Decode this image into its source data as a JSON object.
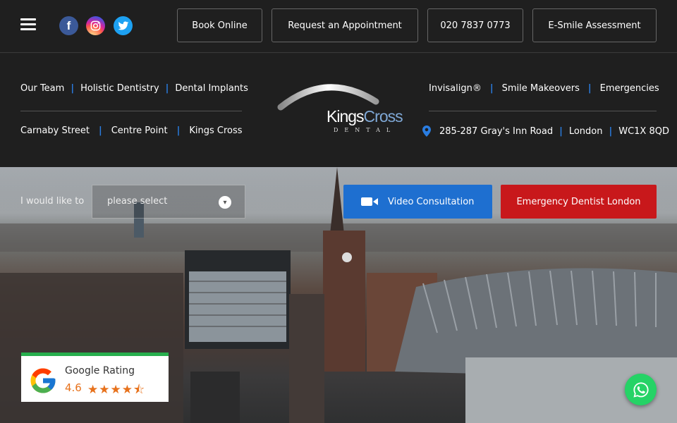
{
  "social": {
    "facebook": "f",
    "instagram": "◎"
  },
  "top_buttons": [
    "Book Online",
    "Request an Appointment",
    "020 7837 0773",
    "E-Smile Assessment"
  ],
  "nav_left_row1": [
    "Our Team",
    "Holistic Dentistry",
    "Dental Implants"
  ],
  "nav_left_row2": [
    "Carnaby Street",
    "Centre Point",
    "Kings Cross"
  ],
  "nav_right_row1": [
    "Invisalign®",
    "Smile Makeovers",
    "Emergencies"
  ],
  "address": [
    "285-287 Gray's Inn Road",
    "London",
    "WC1X 8QD"
  ],
  "logo": {
    "word_a": "Kings",
    "word_b": "Cross",
    "sub": "DENTAL"
  },
  "hero": {
    "intro": "I would like to",
    "select_placeholder": "please select",
    "video_button": "Video Consultation",
    "emergency_button": "Emergency Dentist London"
  },
  "rating": {
    "label": "Google Rating",
    "score": "4.6",
    "stars": "★★★★⯪"
  },
  "colors": {
    "accent_blue": "#1e6fd0",
    "emergency_red": "#c8181b",
    "separator_blue": "#2a7de1",
    "rating_green": "#27ae4d",
    "star_orange": "#e7711b",
    "whatsapp_green": "#25d366"
  }
}
